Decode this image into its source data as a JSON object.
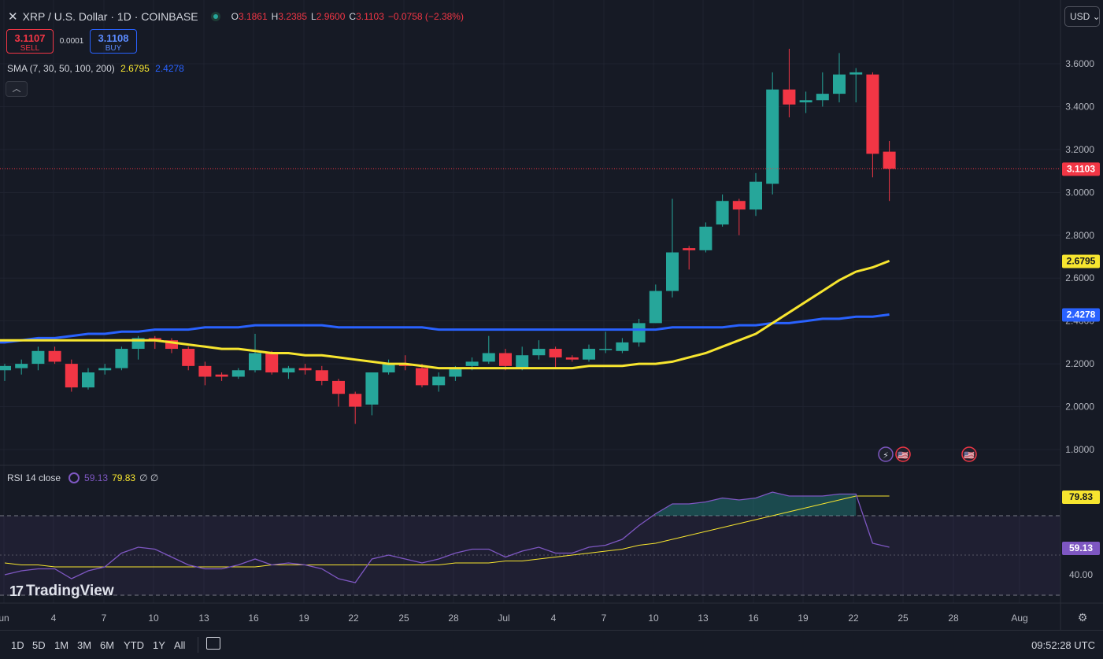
{
  "header": {
    "close_glyph": "✕",
    "symbol": "XRP / U.S. Dollar · 1D · COINBASE",
    "ohlc": [
      {
        "k": "O",
        "v": "3.1861"
      },
      {
        "k": "H",
        "v": "3.2385"
      },
      {
        "k": "L",
        "v": "2.9600"
      },
      {
        "k": "C",
        "v": "3.1103"
      },
      {
        "k": "",
        "v": "−0.0758 (−2.38%)"
      }
    ],
    "currency": "USD ⌄"
  },
  "trade": {
    "sell_price": "3.1107",
    "sell_label": "SELL",
    "spread": "0.0001",
    "buy_price": "3.1108",
    "buy_label": "BUY"
  },
  "sma_legend": {
    "label": "SMA (7, 30, 50, 100, 200)",
    "v1": "2.6795",
    "v2": "2.4278"
  },
  "collapse_glyph": "︿",
  "rsi_legend": {
    "label": "RSI 14 close",
    "v1": "59.13",
    "v2": "79.83",
    "v3": "∅ ∅"
  },
  "brand": {
    "mark": "17",
    "name": "TradingView"
  },
  "colors": {
    "up": "#26a69a",
    "down": "#f23645",
    "sma_fast": "#f7e52f",
    "sma_slow": "#2962ff",
    "rsi": "#7e57c2",
    "rsi_ma": "#f7e52f",
    "background": "#161a25"
  },
  "price_axis": {
    "ticks": [
      "3.6000",
      "3.4000",
      "3.2000",
      "3.0000",
      "2.8000",
      "2.6000",
      "2.4000",
      "2.2000",
      "2.0000",
      "1.8000"
    ],
    "last_price_label": "3.1103",
    "sma_fast_label": "2.6795",
    "sma_slow_label": "2.4278"
  },
  "rsi_axis": {
    "ticks": [
      "40.00"
    ],
    "rsi_label": "59.13",
    "ma_label": "79.83"
  },
  "time_axis": {
    "labels": [
      "un",
      "4",
      "7",
      "10",
      "13",
      "16",
      "19",
      "22",
      "25",
      "28",
      "Jul",
      "4",
      "7",
      "10",
      "13",
      "16",
      "19",
      "22",
      "25",
      "28",
      "Aug"
    ]
  },
  "timeframes": [
    "1D",
    "5D",
    "1M",
    "3M",
    "6M",
    "YTD",
    "1Y",
    "All"
  ],
  "clock": "09:52:28 UTC",
  "chart_data": {
    "type": "candlestick",
    "title": "XRP / U.S. Dollar · 1D · COINBASE",
    "ylim": [
      1.75,
      3.75
    ],
    "candles": [
      [
        2.17,
        2.2,
        2.12,
        2.19
      ],
      [
        2.18,
        2.22,
        2.15,
        2.2
      ],
      [
        2.2,
        2.28,
        2.17,
        2.26
      ],
      [
        2.26,
        2.28,
        2.2,
        2.21
      ],
      [
        2.2,
        2.22,
        2.07,
        2.09
      ],
      [
        2.09,
        2.18,
        2.08,
        2.16
      ],
      [
        2.17,
        2.2,
        2.15,
        2.18
      ],
      [
        2.18,
        2.28,
        2.17,
        2.27
      ],
      [
        2.27,
        2.33,
        2.22,
        2.32
      ],
      [
        2.32,
        2.33,
        2.27,
        2.31
      ],
      [
        2.31,
        2.32,
        2.25,
        2.27
      ],
      [
        2.27,
        2.28,
        2.17,
        2.19
      ],
      [
        2.19,
        2.21,
        2.1,
        2.14
      ],
      [
        2.15,
        2.16,
        2.12,
        2.14
      ],
      [
        2.14,
        2.18,
        2.13,
        2.17
      ],
      [
        2.17,
        2.34,
        2.16,
        2.25
      ],
      [
        2.25,
        2.26,
        2.15,
        2.16
      ],
      [
        2.16,
        2.19,
        2.13,
        2.18
      ],
      [
        2.18,
        2.2,
        2.15,
        2.17
      ],
      [
        2.17,
        2.19,
        2.1,
        2.12
      ],
      [
        2.12,
        2.13,
        2.0,
        2.06
      ],
      [
        2.06,
        2.07,
        1.92,
        2.0
      ],
      [
        2.01,
        2.16,
        1.96,
        2.16
      ],
      [
        2.16,
        2.22,
        2.15,
        2.2
      ],
      [
        2.2,
        2.24,
        2.17,
        2.19
      ],
      [
        2.18,
        2.2,
        2.09,
        2.1
      ],
      [
        2.1,
        2.16,
        2.07,
        2.14
      ],
      [
        2.14,
        2.19,
        2.12,
        2.18
      ],
      [
        2.19,
        2.23,
        2.17,
        2.21
      ],
      [
        2.21,
        2.33,
        2.2,
        2.25
      ],
      [
        2.25,
        2.27,
        2.17,
        2.19
      ],
      [
        2.18,
        2.28,
        2.17,
        2.24
      ],
      [
        2.24,
        2.31,
        2.22,
        2.27
      ],
      [
        2.27,
        2.28,
        2.18,
        2.23
      ],
      [
        2.23,
        2.24,
        2.21,
        2.22
      ],
      [
        2.22,
        2.29,
        2.21,
        2.27
      ],
      [
        2.27,
        2.35,
        2.25,
        2.27
      ],
      [
        2.26,
        2.32,
        2.25,
        2.3
      ],
      [
        2.3,
        2.41,
        2.28,
        2.39
      ],
      [
        2.39,
        2.57,
        2.39,
        2.54
      ],
      [
        2.54,
        2.97,
        2.51,
        2.72
      ],
      [
        2.74,
        2.75,
        2.64,
        2.73
      ],
      [
        2.73,
        2.86,
        2.72,
        2.84
      ],
      [
        2.85,
        2.99,
        2.84,
        2.96
      ],
      [
        2.96,
        2.97,
        2.8,
        2.92
      ],
      [
        2.92,
        3.09,
        2.89,
        3.05
      ],
      [
        3.04,
        3.56,
        2.99,
        3.48
      ],
      [
        3.48,
        3.67,
        3.35,
        3.41
      ],
      [
        3.42,
        3.47,
        3.37,
        3.43
      ],
      [
        3.43,
        3.56,
        3.4,
        3.46
      ],
      [
        3.46,
        3.65,
        3.42,
        3.55
      ],
      [
        3.55,
        3.58,
        3.42,
        3.56
      ],
      [
        3.55,
        3.56,
        3.07,
        3.18
      ],
      [
        3.19,
        3.24,
        2.96,
        3.11
      ]
    ],
    "series": [
      {
        "name": "SMA fast",
        "values": [
          2.31,
          2.31,
          2.31,
          2.31,
          2.31,
          2.31,
          2.31,
          2.31,
          2.31,
          2.31,
          2.3,
          2.29,
          2.28,
          2.27,
          2.27,
          2.26,
          2.25,
          2.25,
          2.24,
          2.24,
          2.23,
          2.22,
          2.21,
          2.2,
          2.2,
          2.19,
          2.18,
          2.18,
          2.18,
          2.18,
          2.18,
          2.18,
          2.18,
          2.18,
          2.18,
          2.19,
          2.19,
          2.19,
          2.2,
          2.2,
          2.21,
          2.23,
          2.25,
          2.28,
          2.31,
          2.34,
          2.39,
          2.44,
          2.49,
          2.54,
          2.59,
          2.63,
          2.65,
          2.68
        ]
      },
      {
        "name": "SMA slow",
        "values": [
          2.3,
          2.31,
          2.32,
          2.32,
          2.33,
          2.34,
          2.34,
          2.35,
          2.35,
          2.36,
          2.36,
          2.36,
          2.37,
          2.37,
          2.37,
          2.38,
          2.38,
          2.38,
          2.38,
          2.38,
          2.37,
          2.37,
          2.37,
          2.37,
          2.37,
          2.37,
          2.36,
          2.36,
          2.36,
          2.36,
          2.36,
          2.36,
          2.36,
          2.36,
          2.36,
          2.36,
          2.36,
          2.36,
          2.36,
          2.36,
          2.37,
          2.37,
          2.37,
          2.37,
          2.38,
          2.38,
          2.39,
          2.39,
          2.4,
          2.41,
          2.41,
          2.42,
          2.42,
          2.43
        ]
      },
      {
        "name": "RSI 14",
        "values": [
          40,
          42,
          43,
          43,
          38,
          42,
          44,
          51,
          54,
          53,
          49,
          45,
          43,
          43,
          45,
          48,
          45,
          46,
          45,
          43,
          38,
          36,
          48,
          50,
          48,
          46,
          48,
          51,
          53,
          53,
          49,
          52,
          54,
          51,
          51,
          54,
          55,
          58,
          65,
          71,
          76,
          76,
          77,
          79,
          78,
          79,
          82,
          80,
          80,
          80,
          81,
          81,
          56,
          54
        ]
      },
      {
        "name": "RSI MA",
        "values": [
          46,
          45,
          45,
          44,
          44,
          44,
          44,
          44,
          44,
          44,
          44,
          44,
          44,
          44,
          44,
          44,
          45,
          45,
          45,
          45,
          45,
          45,
          45,
          45,
          45,
          45,
          45,
          46,
          46,
          46,
          47,
          47,
          48,
          49,
          50,
          51,
          52,
          53,
          55,
          56,
          58,
          60,
          62,
          64,
          66,
          68,
          70,
          72,
          74,
          76,
          78,
          80,
          80,
          80
        ]
      }
    ],
    "rsi_ylim": [
      30,
      88
    ],
    "rsi_bands": [
      30,
      70
    ],
    "markers": [
      "⚡",
      "🇺🇸",
      "🇺🇸"
    ]
  }
}
